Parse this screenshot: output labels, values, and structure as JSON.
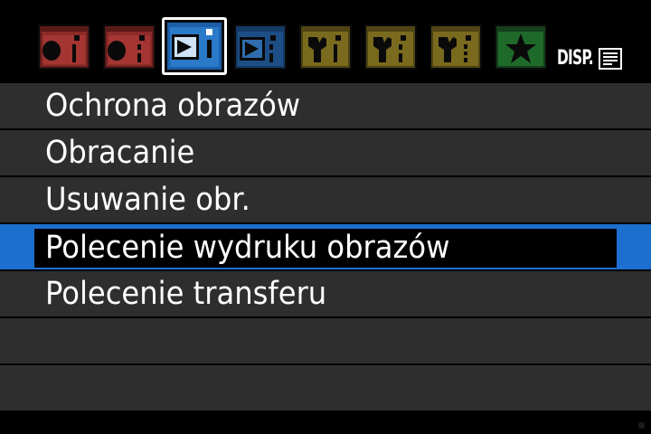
{
  "tabs": [
    {
      "name": "shooting-1",
      "icon": "camera-icon",
      "color": "#8c2a28"
    },
    {
      "name": "shooting-2",
      "icon": "camera-icon",
      "color": "#8c2a28"
    },
    {
      "name": "playback-1",
      "icon": "playback-icon",
      "color": "#2a7ac9",
      "active": true
    },
    {
      "name": "playback-2",
      "icon": "playback-icon",
      "color": "#1d4f86"
    },
    {
      "name": "setup-1",
      "icon": "wrench-icon",
      "color": "#7a6a1e"
    },
    {
      "name": "setup-2",
      "icon": "wrench-icon",
      "color": "#7a6a1e"
    },
    {
      "name": "setup-3",
      "icon": "wrench-icon",
      "color": "#7a6a1e"
    },
    {
      "name": "my-menu",
      "icon": "star-icon",
      "color": "#1f6a2a"
    }
  ],
  "disp": {
    "label": "DISP."
  },
  "menu": {
    "items": [
      {
        "label": "Ochrona obrazów"
      },
      {
        "label": "Obracanie"
      },
      {
        "label": "Usuwanie obr."
      },
      {
        "label": "Polecenie wydruku obrazów",
        "selected": true
      },
      {
        "label": "Polecenie transferu"
      },
      {
        "label": ""
      },
      {
        "label": ""
      }
    ]
  },
  "colors": {
    "selection": "#1d6fcf",
    "row_background": "#2e2e2e"
  }
}
